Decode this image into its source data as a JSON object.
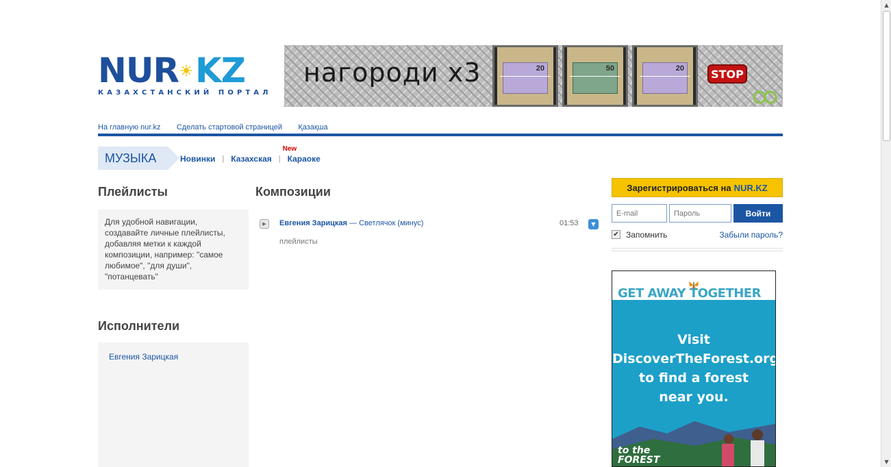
{
  "header": {
    "logo_left": "NUR",
    "logo_right": "KZ",
    "logo_subtitle": "КАЗАХСТАНСКИЙ ПОРТАЛ",
    "banner": {
      "text": "нагороди x3",
      "bill_values": [
        "20",
        "50",
        "20"
      ],
      "stop_label": "STOP"
    }
  },
  "topnav": {
    "items": [
      "На главную nur.kz",
      "Сделать стартовой страницей",
      "Қазақша"
    ]
  },
  "music_nav": {
    "section_label": "МУЗЫКА",
    "items": [
      "Новинки",
      "Казахская",
      "Караоке"
    ],
    "new_badge": "New",
    "separator": "|"
  },
  "left": {
    "playlists_title": "Плейлисты",
    "playlists_info": "Для удобной навигации, создавайте личные плейлисты, добавляя метки к каждой композиции, например: \"самое любимое\", \"для души\", \"потанцевать\"",
    "artists_title": "Исполнители",
    "artists": [
      "Евгения Зарицкая"
    ]
  },
  "center": {
    "title": "Композиции",
    "tracks": [
      {
        "artist": "Евгения Зарицкая",
        "dash": " — ",
        "song": "Светлячок (минус)",
        "duration": "01:53",
        "tags": "плейлисты"
      }
    ]
  },
  "right": {
    "register_text": "Зарегистрироваться на",
    "register_brand": "NUR.KZ",
    "email_placeholder": "E-mail",
    "password_placeholder": "Пароль",
    "login_button": "Войти",
    "remember_label": "Запомнить",
    "forgot_link": "Забыли пароль?",
    "ad": {
      "headline": "GET AWAY TOGETHER",
      "body_lines": [
        "Visit",
        "DiscoverTheForest.org",
        "to find a forest",
        "near you."
      ],
      "footer_line1": "to the",
      "footer_line2": "FOREST"
    }
  },
  "icons": {
    "logo_sun": "sun-icon",
    "play": "play-icon",
    "download": "download-icon",
    "checkbox": "checkmark-icon",
    "butterfly": "butterfly-icon"
  },
  "colors": {
    "brand_blue": "#1c56a3",
    "light_blue": "#1e9bd7",
    "register_yellow": "#f6c300",
    "new_red": "#d40000"
  }
}
